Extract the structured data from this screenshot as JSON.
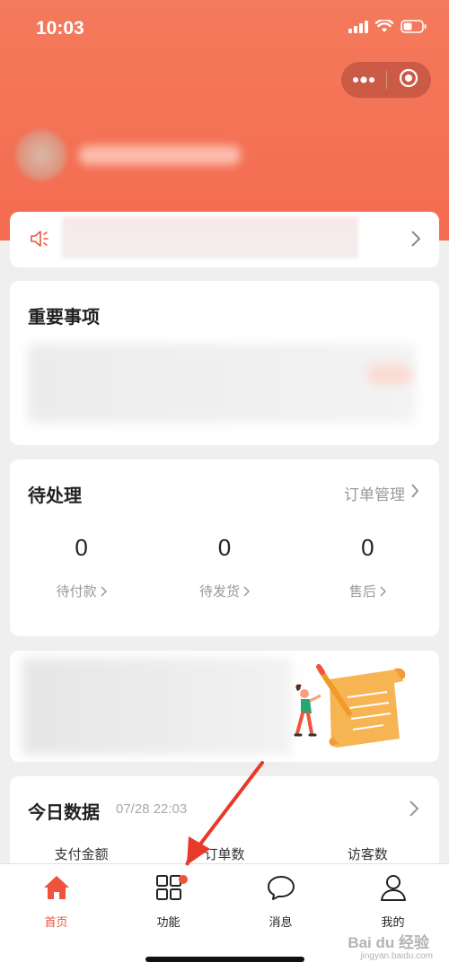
{
  "status_bar": {
    "time": "10:03"
  },
  "notice": {},
  "important": {
    "title": "重要事项"
  },
  "pending": {
    "title": "待处理",
    "link_label": "订单管理",
    "items": [
      {
        "count": "0",
        "label": "待付款"
      },
      {
        "count": "0",
        "label": "待发货"
      },
      {
        "count": "0",
        "label": "售后"
      }
    ]
  },
  "today": {
    "title": "今日数据",
    "date": "07/28 22:03",
    "metrics": [
      "支付金额",
      "订单数",
      "访客数"
    ]
  },
  "tabbar": {
    "tabs": [
      {
        "label": "首页",
        "icon": "home-icon",
        "active": true
      },
      {
        "label": "功能",
        "icon": "grid-icon",
        "badge": true
      },
      {
        "label": "消息",
        "icon": "chat-bubble-icon"
      },
      {
        "label": "我的",
        "icon": "person-icon"
      }
    ]
  },
  "watermark": {
    "text": "Bai du 经验",
    "sub": "jingyan.baidu.com"
  },
  "colors": {
    "accent": "#f0533b",
    "header": "#f47a5c"
  }
}
